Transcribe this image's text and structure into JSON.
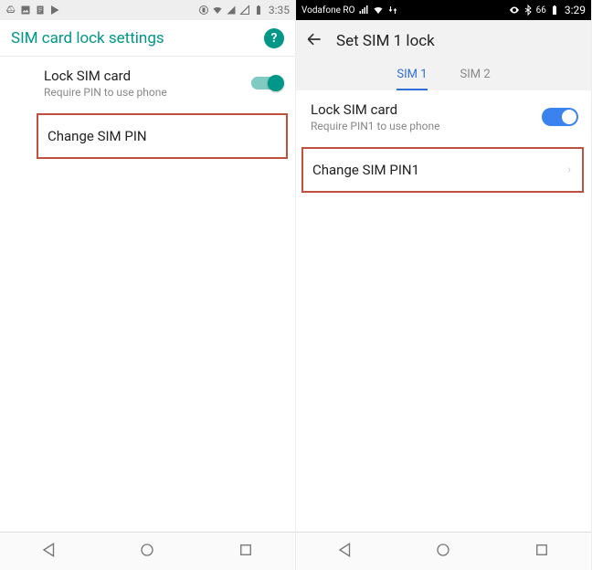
{
  "left": {
    "statusbar": {
      "time": "3:35"
    },
    "header": {
      "title": "SIM card lock settings",
      "help": "?"
    },
    "lock_row": {
      "title": "Lock SIM card",
      "subtitle": "Require PIN to use phone"
    },
    "change_pin": {
      "title": "Change SIM PIN"
    }
  },
  "right": {
    "statusbar": {
      "carrier": "Vodafone RO",
      "time": "3:29",
      "battery": "66"
    },
    "header": {
      "title": "Set SIM 1 lock"
    },
    "tabs": {
      "sim1": "SIM 1",
      "sim2": "SIM 2"
    },
    "lock_row": {
      "title": "Lock SIM card",
      "subtitle": "Require PIN1 to use phone"
    },
    "change_pin": {
      "title": "Change SIM PIN1"
    }
  }
}
